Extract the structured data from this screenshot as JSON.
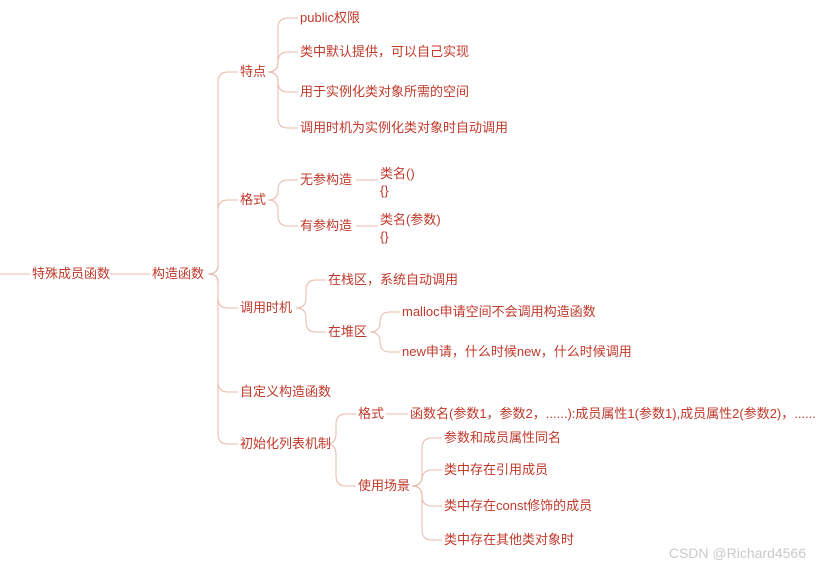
{
  "root": "特殊成员函数",
  "l1_a": "构造函数",
  "l2_a": "特点",
  "l2_a_1": "public权限",
  "l2_a_2": "类中默认提供，可以自己实现",
  "l2_a_3": "用于实例化类对象所需的空间",
  "l2_a_4": "调用时机为实例化类对象时自动调用",
  "l2_b": "格式",
  "l2_b_1": "无参构造",
  "l2_b_1_val": "类名()\n{}",
  "l2_b_2": "有参构造",
  "l2_b_2_val": "类名(参数)\n{}",
  "l2_c": "调用时机",
  "l2_c_1": "在栈区，系统自动调用",
  "l2_c_2": "在堆区",
  "l2_c_2_a": "malloc申请空间不会调用构造函数",
  "l2_c_2_b": "new申请，什么时候new，什么时候调用",
  "l2_d": "自定义构造函数",
  "l2_e": "初始化列表机制",
  "l2_e_1": "格式",
  "l2_e_1_val": "函数名(参数1，参数2，......):成员属性1(参数1),成员属性2(参数2)，......",
  "l2_e_2": "使用场景",
  "l2_e_2_a": "参数和成员属性同名",
  "l2_e_2_b": "类中存在引用成员",
  "l2_e_2_c": "类中存在const修饰的成员",
  "l2_e_2_d": "类中存在其他类对象时",
  "watermark": "CSDN @Richard4566"
}
